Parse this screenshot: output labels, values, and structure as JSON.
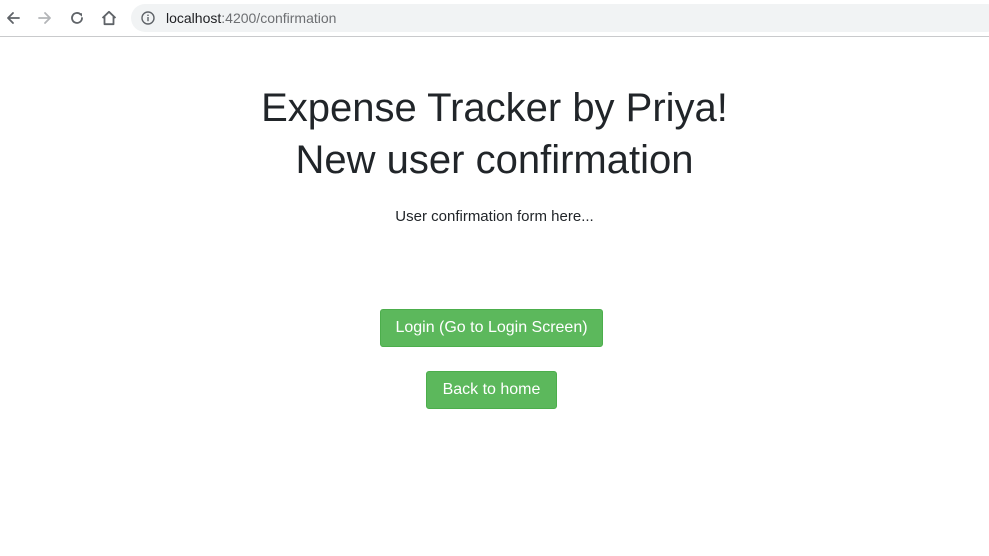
{
  "browser": {
    "url_host": "localhost",
    "url_rest": ":4200/confirmation",
    "icons": {
      "back": "arrow-left-icon",
      "forward": "arrow-right-icon",
      "reload": "reload-icon",
      "home": "home-icon",
      "site_info": "info-icon"
    }
  },
  "page": {
    "title_line_1": "Expense Tracker by Priya!",
    "title_line_2": "New user confirmation",
    "subtext": "User confirmation form here...",
    "login_button": "Login (Go to Login Screen)",
    "home_button": "Back to home"
  },
  "colors": {
    "button_green": "#5cb85c",
    "text": "#212529"
  }
}
